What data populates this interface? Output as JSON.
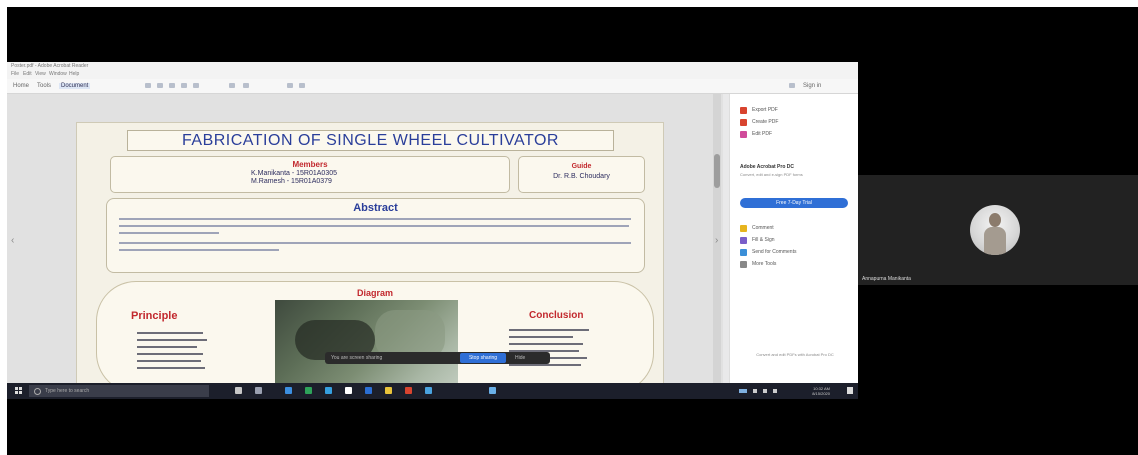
{
  "meeting": {
    "participant_name": "Annapurna Manikanta",
    "share_bar": {
      "text": "You are screen sharing",
      "stop_label": "Stop sharing",
      "hide_label": "Hide"
    }
  },
  "viewer": {
    "window_title": "Poster.pdf - Adobe Acrobat Reader",
    "menu": [
      "File",
      "Edit",
      "View",
      "Window",
      "Help"
    ],
    "tabs": [
      "Home",
      "Tools",
      "Document"
    ],
    "sign_in_label": "Sign in",
    "prev_page_glyph": "‹",
    "next_page_glyph": "›",
    "tools": [
      {
        "label": "Export PDF",
        "color": "#d8442f"
      },
      {
        "label": "Create PDF",
        "color": "#d8442f"
      },
      {
        "label": "Edit PDF",
        "color": "#d04b9a"
      },
      {
        "label": "Comment",
        "color": "#e6b41e"
      },
      {
        "label": "Fill & Sign",
        "color": "#7a5ec9"
      },
      {
        "label": "Send for Comments",
        "color": "#3b8fd8"
      },
      {
        "label": "More Tools",
        "color": "#888888"
      }
    ],
    "promo_title": "Adobe Acrobat Pro DC",
    "promo_sub": "Convert, edit and e-sign PDF forms",
    "try_label": "Free 7-Day Trial",
    "sign_note": "Convert and edit PDFs with Acrobat Pro DC"
  },
  "poster": {
    "title": "FABRICATION OF SINGLE WHEEL CULTIVATOR",
    "members_heading": "Members",
    "members": [
      "K.Manikanta - 15R01A0305",
      "M.Ramesh - 15R01A0379"
    ],
    "guide_heading": "Guide",
    "guide_name": "Dr. R.B. Choudary",
    "abstract_heading": "Abstract",
    "diagram_heading": "Diagram",
    "principle_heading": "Principle",
    "conclusion_heading": "Conclusion"
  },
  "taskbar": {
    "search_placeholder": "Type here to search",
    "time": "10:32 AM",
    "date": "8/15/2020"
  }
}
